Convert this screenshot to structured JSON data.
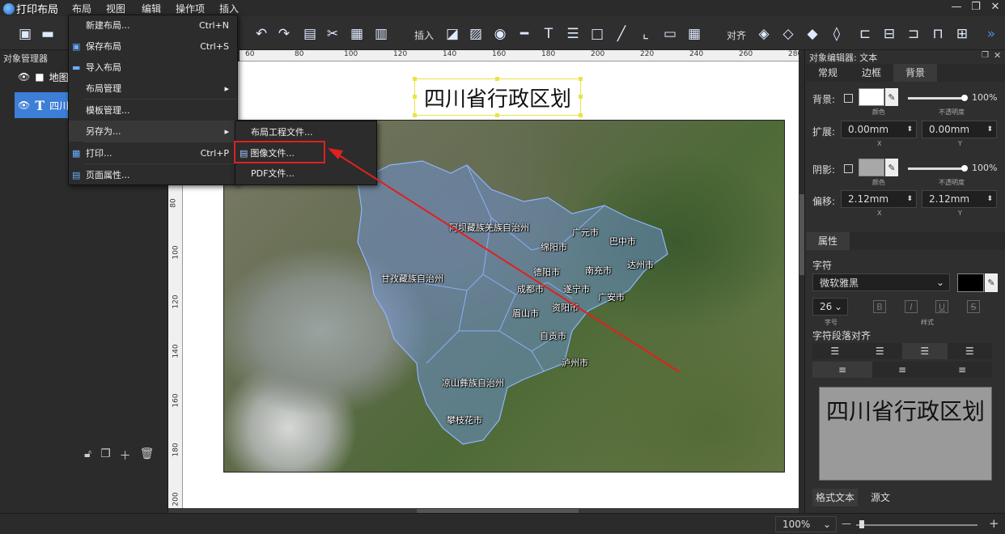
{
  "app": {
    "title": "打印布局"
  },
  "menubar": [
    "布局",
    "视图",
    "编辑",
    "操作项",
    "插入"
  ],
  "window_controls": {
    "minimize": "—",
    "restore": "❐",
    "close": "✕"
  },
  "toolbar": {
    "insert_label": "插入",
    "align_label": "对齐"
  },
  "left_panel": {
    "title": "对象管理器",
    "items": [
      {
        "label": "地图1",
        "icon": "folder-icon"
      },
      {
        "label": "四川省",
        "icon": "text-icon"
      }
    ]
  },
  "ruler": {
    "h_ticks": [
      "60",
      "80",
      "100",
      "120",
      "140",
      "160",
      "180",
      "200",
      "220",
      "240",
      "260",
      "280"
    ],
    "v_ticks": [
      "80",
      "100",
      "120",
      "140",
      "160",
      "180",
      "200"
    ]
  },
  "map": {
    "title": "四川省行政区划",
    "cities": [
      "阿坝藏族羌族自治州",
      "广元市",
      "巴中市",
      "绵阳市",
      "达州市",
      "南充市",
      "德阳市",
      "甘孜藏族自治州",
      "成都市",
      "遂宁市",
      "广安市",
      "眉山市",
      "资阳市",
      "自贡市",
      "泸州市",
      "凉山彝族自治州",
      "攀枝花市"
    ]
  },
  "layout_menu": {
    "items": [
      {
        "label": "新建布局...",
        "shortcut": "Ctrl+N",
        "icon": ""
      },
      {
        "label": "保存布局",
        "shortcut": "Ctrl+S",
        "icon": "save-icon"
      },
      {
        "label": "导入布局",
        "shortcut": "",
        "icon": "folder-icon"
      },
      {
        "label": "布局管理",
        "shortcut": "",
        "icon": "",
        "submenu": true
      },
      {
        "label": "模板管理...",
        "shortcut": "",
        "icon": ""
      },
      {
        "label": "另存为...",
        "shortcut": "",
        "icon": "",
        "submenu": true
      },
      {
        "label": "打印...",
        "shortcut": "Ctrl+P",
        "icon": "print-icon"
      },
      {
        "label": "页面属性...",
        "shortcut": "",
        "icon": "page-properties-icon"
      }
    ]
  },
  "saveas_submenu": {
    "items": [
      {
        "label": "布局工程文件..."
      },
      {
        "label": "图像文件...",
        "highlighted": true
      },
      {
        "label": "PDF文件..."
      }
    ]
  },
  "right_panel": {
    "title": "对象编辑器: 文本",
    "tabs": [
      "常规",
      "边框",
      "背景"
    ],
    "active_tab": "背景",
    "background": {
      "label": "背景:",
      "color": "#ffffff",
      "color_caption": "颜色",
      "opacity": "100%",
      "opacity_caption": "不透明度"
    },
    "expand": {
      "label": "扩展:",
      "x": "0.00mm",
      "y": "0.00mm",
      "x_caption": "X",
      "y_caption": "Y"
    },
    "shadow": {
      "label": "阴影:",
      "color": "#a8a8a8",
      "color_caption": "颜色",
      "opacity": "100%",
      "opacity_caption": "不透明度"
    },
    "offset": {
      "label": "偏移:",
      "x": "2.12mm",
      "y": "2.12mm",
      "x_caption": "X",
      "y_caption": "Y"
    },
    "properties_tab": "属性",
    "font_section": "字符",
    "font_family": "微软雅黑",
    "font_color": "#000000",
    "font_size": "26",
    "font_size_caption": "字号",
    "style_caption": "样式",
    "style_buttons": [
      "B",
      "I",
      "U",
      "S"
    ],
    "align_section": "字符段落对齐",
    "preview_text": "四川省行政区划",
    "preview_tabs": [
      "格式文本",
      "源文"
    ]
  },
  "statusbar": {
    "zoom": "100%",
    "zoom_out": "—",
    "zoom_in": "+"
  }
}
